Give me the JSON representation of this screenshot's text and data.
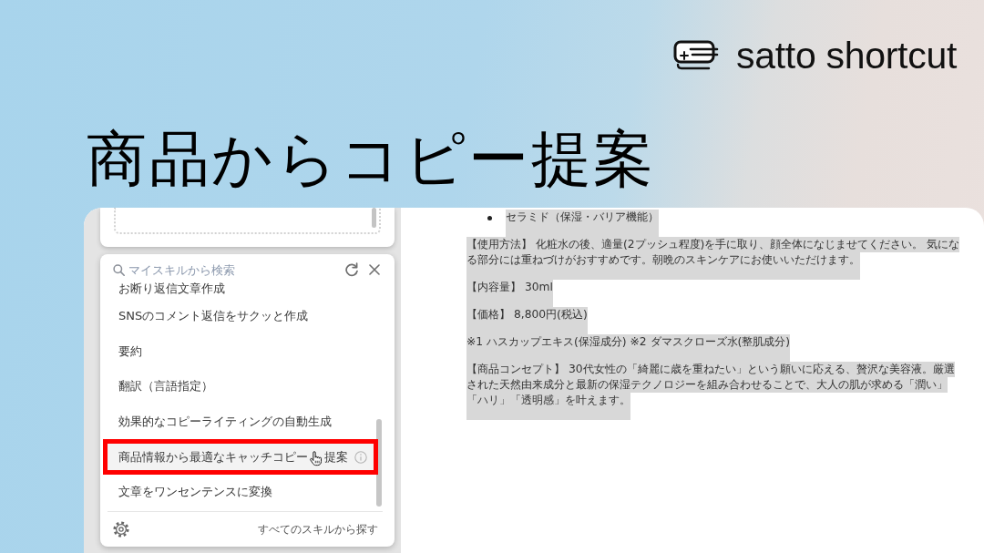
{
  "brand": {
    "name": "satto shortcut"
  },
  "title": "商品からコピー提案",
  "skill_menu": {
    "search": {
      "placeholder": "マイスキルから検索"
    },
    "items": [
      {
        "label": "お断り返信文章作成",
        "selected": false,
        "callout": false
      },
      {
        "label": "SNSのコメント返信をサクッと作成",
        "selected": false,
        "callout": false
      },
      {
        "label": "要約",
        "selected": false,
        "callout": false
      },
      {
        "label": "翻訳（言語指定）",
        "selected": false,
        "callout": false
      },
      {
        "label": "効果的なコピーライティングの自動生成",
        "selected": false,
        "callout": false
      },
      {
        "label": "商品情報から最適なキャッチコピー",
        "label_tail": "提案",
        "selected": true,
        "callout": true
      },
      {
        "label": "文章をワンセンテンスに変換",
        "selected": false,
        "callout": false
      }
    ],
    "footer_link": "すべてのスキルから探す"
  },
  "document": {
    "bullets": [
      {
        "text": "セラミド（保湿・バリア機能）",
        "selected": true
      }
    ],
    "paragraphs": [
      {
        "lines": [
          "【使用方法】 化粧水の後、適量(2プッシュ程度)を手に取り、顔全体になじませてください。 気にな",
          "る部分には重ねづけがおすすめです。朝晩のスキンケアにお使いいただけます。"
        ],
        "selected": true
      },
      {
        "lines": [
          "【内容量】 30ml"
        ],
        "selected": true
      },
      {
        "lines": [
          "【価格】 8,800円(税込)"
        ],
        "selected": true
      },
      {
        "lines": [
          "※1 ハスカップエキス(保湿成分) ※2 ダマスクローズ水(整肌成分)"
        ],
        "selected": true
      },
      {
        "lines": [
          "【商品コンセプト】 30代女性の「綺麗に歳を重ねたい」という願いに応える、贅沢な美容液。厳選",
          "された天然由来成分と最新の保湿テクノロジーを組み合わせることで、大人の肌が求める「潤い」",
          "「ハリ」「透明感」を叶えます。"
        ],
        "selected": true
      }
    ]
  }
}
